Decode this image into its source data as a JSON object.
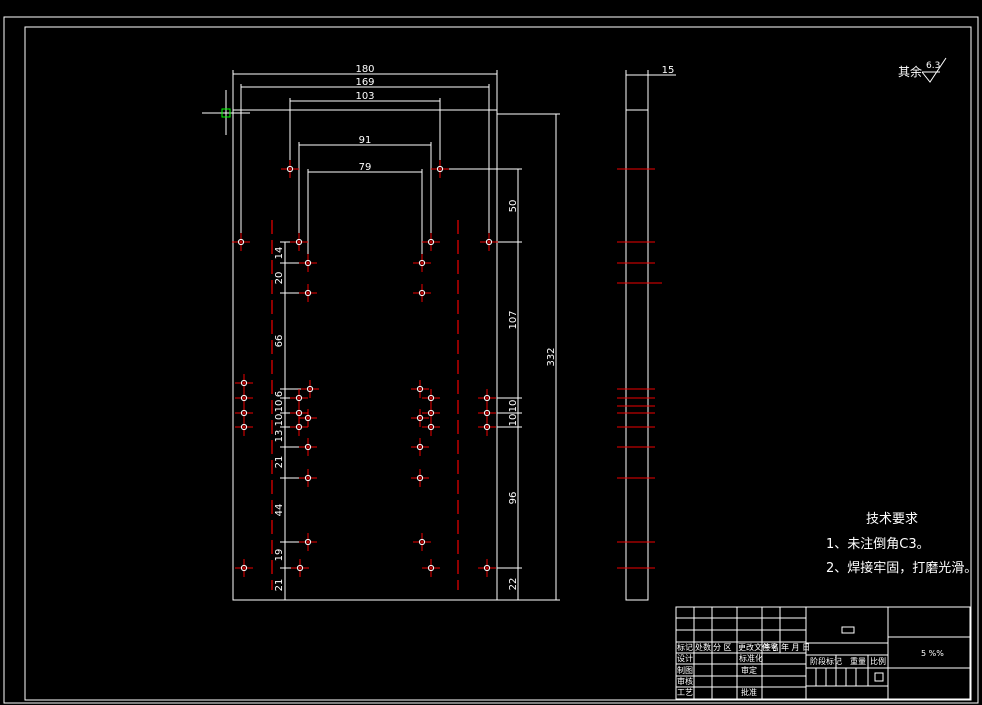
{
  "top_dims": [
    "180",
    "169",
    "103",
    "91",
    "79"
  ],
  "side_view_dim": "15",
  "right_dims": [
    "50",
    "107",
    "10",
    "10",
    "96",
    "22"
  ],
  "overall_height_dim": "332",
  "left_dims": [
    "14",
    "20",
    "66",
    "6",
    "10",
    "10",
    "13",
    "21",
    "44",
    "19",
    "21"
  ],
  "roughness": {
    "prefix": "其余",
    "value": "6.3"
  },
  "tech_requirements": {
    "title": "技术要求",
    "items": [
      "1、未注倒角C3。",
      "2、焊接牢固，打磨光滑。"
    ]
  },
  "title_block": {
    "header_row": [
      "标记",
      "处数",
      "分 区",
      "更改文件号",
      "签名",
      "年 月 日"
    ],
    "design": "设计",
    "standardize": "标准化",
    "draw": "制图",
    "review_mid": "审定",
    "check": "审核",
    "process": "工艺",
    "approve": "批准",
    "stage_mark": "阶段标记",
    "weight": "重量",
    "scale": "比例",
    "company": "5 %%"
  }
}
